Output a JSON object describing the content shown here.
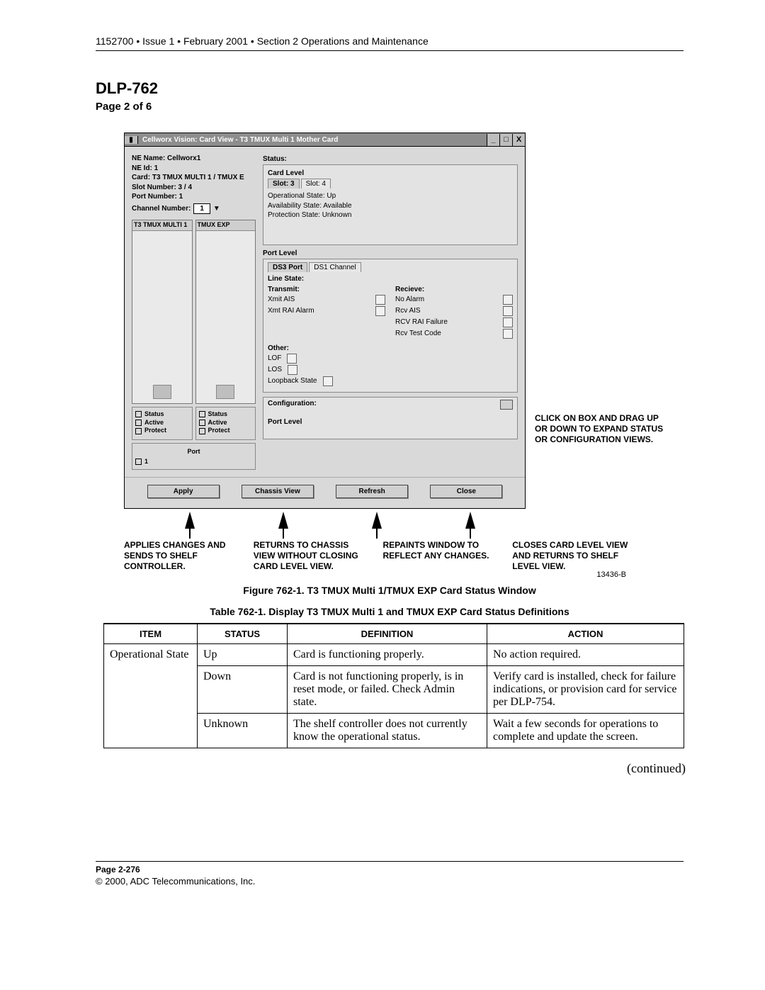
{
  "doc": {
    "header": "1152700 • Issue 1 • February 2001 • Section 2 Operations and Maintenance",
    "title": "DLP-762",
    "page_label": "Page 2 of 6",
    "footer_page": "Page 2-276",
    "footer_copy": "© 2000, ADC Telecommunications, Inc."
  },
  "window": {
    "title": "Cellworx Vision:   Card View - T3 TMUX Multi 1 Mother Card",
    "win_min": "_",
    "win_max": "□",
    "win_close": "X",
    "ne_name": "NE Name: Cellworx1",
    "ne_id": "NE Id:  1",
    "card": "Card: T3 TMUX MULTI 1 / TMUX E",
    "slot": "Slot Number:  3 / 4",
    "port": "Port Number:  1",
    "channel_lbl": "Channel Number:",
    "channel_val": "1",
    "col1": "T3 TMUX MULTI 1",
    "col2": "TMUX EXP",
    "status_items": {
      "a": "Status",
      "b": "Active",
      "c": "Protect"
    },
    "port_lbl": "Port",
    "port1": "1",
    "status_hdr": "Status:",
    "cardlevel": "Card Level",
    "slot3": "Slot: 3",
    "slot4": "Slot: 4",
    "op_state": "Operational State:  Up",
    "avail_state": "Availability State:  Available",
    "prot_state": "Protection State:   Unknown",
    "portlevel": "Port Level",
    "tab_ds3": "DS3 Port",
    "tab_ds1": "DS1 Channel",
    "line_state": "Line State:",
    "transmit": "Transmit:",
    "recieve": "Recieve:",
    "xmit_ais": "Xmit AIS",
    "xmt_rai": "Xmt RAI Alarm",
    "no_alarm": "No Alarm",
    "rcv_ais": "Rcv AIS",
    "rcv_rai": "RCV RAI Failure",
    "rcv_test": "Rcv Test Code",
    "other": "Other:",
    "lof": "LOF",
    "los": "LOS",
    "loopback": "Loopback State",
    "config": "Configuration:",
    "cfg_port": "Port Level",
    "btn_apply": "Apply",
    "btn_chassis": "Chassis View",
    "btn_refresh": "Refresh",
    "btn_close": "Close"
  },
  "callouts": {
    "side": "CLICK ON BOX AND DRAG UP OR DOWN TO EXPAND STATUS OR CONFIGURATION VIEWS.",
    "c1": "APPLIES CHANGES AND SENDS TO SHELF CONTROLLER.",
    "c2": "RETURNS TO CHASSIS VIEW WITHOUT CLOSING CARD LEVEL VIEW.",
    "c3": "REPAINTS WINDOW TO REFLECT ANY CHANGES.",
    "c4": "CLOSES CARD LEVEL VIEW AND RETURNS TO SHELF LEVEL VIEW.",
    "figref": "13436-B"
  },
  "captions": {
    "fig": "Figure 762-1. T3 TMUX Multi 1/TMUX EXP Card Status Window",
    "tbl": "Table 762-1. Display T3 TMUX Multi 1 and TMUX EXP Card Status Definitions"
  },
  "table": {
    "headers": {
      "item": "ITEM",
      "status": "STATUS",
      "def": "DEFINITION",
      "act": "ACTION"
    },
    "rows": [
      {
        "item": "Operational State",
        "status": "Up",
        "def": "Card is functioning properly.",
        "act": "No action required."
      },
      {
        "item": "",
        "status": "Down",
        "def": "Card is not functioning properly, is in reset mode, or failed. Check Admin state.",
        "act": "Verify card is installed, check for failure indications, or provision card for service per DLP-754."
      },
      {
        "item": "",
        "status": "Unknown",
        "def": "The shelf controller does not currently know the operational status.",
        "act": "Wait a few seconds for operations to complete and update the screen."
      }
    ],
    "continued": "(continued)"
  }
}
